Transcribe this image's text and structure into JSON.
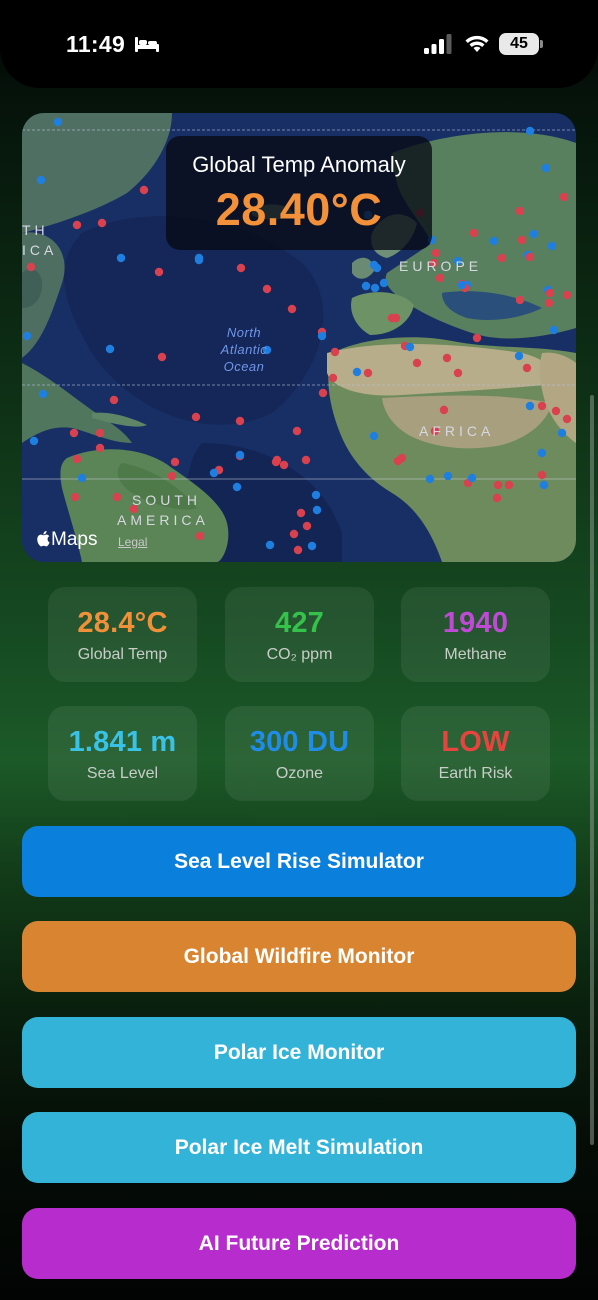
{
  "status_bar": {
    "time": "11:49",
    "battery": "45",
    "icons": [
      "bed-icon",
      "signal-icon",
      "wifi-icon",
      "battery-icon"
    ]
  },
  "map": {
    "anomaly_title": "Global Temp Anomaly",
    "anomaly_value": "28.40°C",
    "labels": {
      "europe": "EUROPE",
      "africa": "AFRICA",
      "south_america_1": "SOUTH",
      "south_america_2": "AMERICA",
      "north_america_1": "TH",
      "north_america_2": "ICA",
      "ocean_1": "North",
      "ocean_2": "Atlantic",
      "ocean_3": "Ocean"
    },
    "attribution": "Maps",
    "legal": "Legal",
    "marker_colors": {
      "warm": "#d9414f",
      "cool": "#1f7fe0"
    }
  },
  "stats": [
    {
      "value": "28.4°C",
      "label": "Global Temp",
      "color": "#f0913a"
    },
    {
      "value": "427",
      "label": "CO₂ ppm",
      "color": "#35c24a"
    },
    {
      "value": "1940",
      "label": "Methane",
      "color": "#c04ad6"
    },
    {
      "value": "1.841 m",
      "label": "Sea Level",
      "color": "#38c3e6"
    },
    {
      "value": "300 DU",
      "label": "Ozone",
      "color": "#1f8ce8"
    },
    {
      "value": "LOW",
      "label": "Earth Risk",
      "color": "#e8443f"
    }
  ],
  "buttons": [
    {
      "label": "Sea Level Rise Simulator",
      "color": "#0a7fdc"
    },
    {
      "label": "Global Wildfire Monitor",
      "color": "#d98430"
    },
    {
      "label": "Polar Ice Monitor",
      "color": "#33b3d8"
    },
    {
      "label": "Polar Ice Melt Simulation",
      "color": "#33b3d8"
    },
    {
      "label": "AI Future Prediction",
      "color": "#b72ccc"
    }
  ]
}
